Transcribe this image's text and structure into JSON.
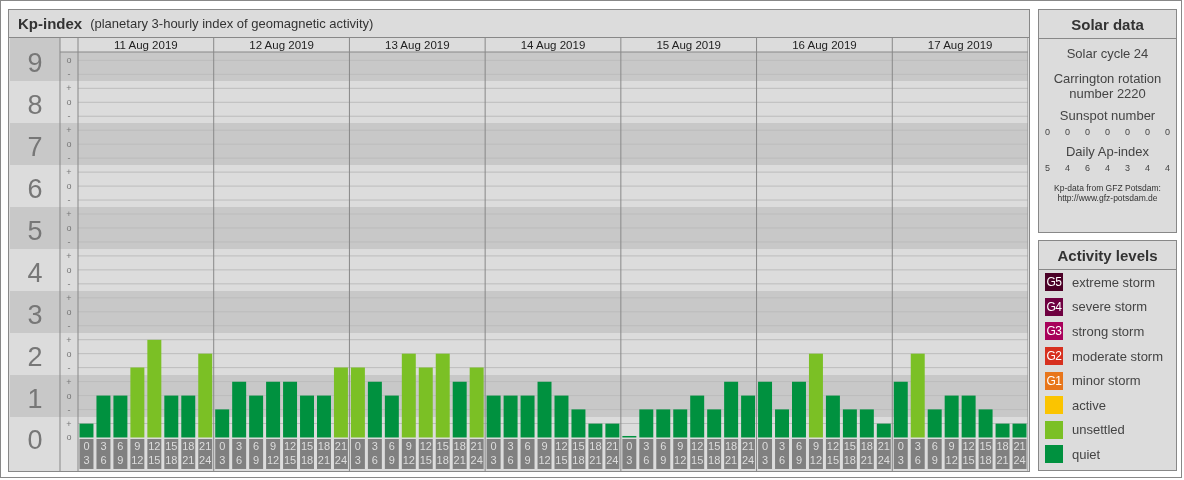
{
  "kp_panel": {
    "title": "Kp-index",
    "subtitle": "(planetary 3-hourly index of geomagnetic activity)",
    "days": [
      "11 Aug 2019",
      "12 Aug 2019",
      "13 Aug 2019",
      "14 Aug 2019",
      "15 Aug 2019",
      "16 Aug 2019",
      "17 Aug 2019"
    ],
    "sub_marks": [
      "o",
      "-",
      "+",
      "o",
      "-",
      "+",
      "o",
      "-",
      "+",
      "o",
      "-",
      "+",
      "o",
      "-",
      "+",
      "o",
      "-",
      "+",
      "o",
      "-",
      "+",
      "o",
      "-",
      "+",
      "o",
      "-",
      "+",
      "o"
    ],
    "chart_data": {
      "type": "bar",
      "stacked": true,
      "grid": true,
      "ylim": [
        -0.8,
        9.2
      ],
      "yticks": [
        {
          "value": 0,
          "label": "0"
        },
        {
          "value": 1,
          "label": "1"
        },
        {
          "value": 2,
          "label": "2"
        },
        {
          "value": 3,
          "label": "3"
        },
        {
          "value": 4,
          "label": "4"
        },
        {
          "value": 5,
          "label": "5"
        },
        {
          "value": 6,
          "label": "6"
        },
        {
          "value": 7,
          "label": "7"
        },
        {
          "value": 8,
          "label": "8"
        },
        {
          "value": 9,
          "label": "9"
        }
      ],
      "categories": [
        "0 3",
        "3 6",
        "6 9",
        "9 12",
        "12 15",
        "15 18",
        "18 21",
        "21 24",
        "0 3",
        "3 6",
        "6 9",
        "9 12",
        "12 15",
        "15 18",
        "18 21",
        "21 24",
        "0 3",
        "3 6",
        "6 9",
        "9 12",
        "12 15",
        "15 18",
        "18 21",
        "21 24",
        "0 3",
        "3 6",
        "6 9",
        "9 12",
        "12 15",
        "15 18",
        "18 21",
        "21 24",
        "0 3",
        "3 6",
        "6 9",
        "9 12",
        "12 15",
        "15 18",
        "18 21",
        "21 24",
        "0 3",
        "3 6",
        "6 9",
        "9 12",
        "12 15",
        "15 18",
        "18 21",
        "21 24",
        "0 3",
        "3 6",
        "6 9",
        "9 12",
        "12 15",
        "15 18",
        "18 21",
        "21 24"
      ],
      "series": [
        {
          "color": "#00913f",
          "values": [
            0.33,
            1,
            1,
            null,
            null,
            1,
            1,
            null,
            0.67,
            1.33,
            1,
            1.33,
            1.33,
            1,
            1,
            null,
            null,
            1.33,
            1,
            null,
            null,
            null,
            1.33,
            null,
            1,
            1,
            1,
            1.33,
            1,
            0.67,
            0.33,
            0.33,
            0,
            0.67,
            0.67,
            0.67,
            1,
            0.67,
            1.33,
            1,
            1.33,
            0.67,
            1.33,
            null,
            1,
            0.67,
            0.67,
            0.33,
            1.33,
            null,
            0.67,
            1,
            1,
            0.67,
            0.33,
            0.33
          ]
        },
        {
          "color": "#7bc025",
          "values": [
            null,
            null,
            null,
            1.67,
            2.33,
            null,
            null,
            2,
            null,
            null,
            null,
            null,
            null,
            null,
            null,
            1.67,
            1.67,
            null,
            null,
            2,
            1.67,
            2,
            null,
            1.67,
            null,
            null,
            null,
            null,
            null,
            null,
            null,
            null,
            null,
            null,
            null,
            null,
            null,
            null,
            null,
            null,
            null,
            null,
            null,
            2,
            null,
            null,
            null,
            null,
            null,
            2,
            null,
            null,
            null,
            null,
            null,
            null
          ]
        }
      ]
    }
  },
  "solar_data": {
    "title": "Solar data",
    "solar_cycle": "Solar cycle 24",
    "carrington": "Carrington rotation number 2220",
    "sunspot_label": "Sunspot number",
    "sunspot_numbers": [
      "0",
      "0",
      "0",
      "0",
      "0",
      "0",
      "0"
    ],
    "ap_label": "Daily Ap-index",
    "ap_values": [
      "5",
      "4",
      "6",
      "4",
      "3",
      "4",
      "4"
    ],
    "credit": "Kp-data from GFZ Potsdam:",
    "credit_url": "http://www.gfz-potsdam.de"
  },
  "activity_levels": {
    "title": "Activity levels",
    "items": [
      {
        "badge": "G5",
        "label": "extreme storm",
        "color": "#4b0026"
      },
      {
        "badge": "G4",
        "label": "severe storm",
        "color": "#6e0040"
      },
      {
        "badge": "G3",
        "label": "strong storm",
        "color": "#a8005a"
      },
      {
        "badge": "G2",
        "label": "moderate storm",
        "color": "#d7301f"
      },
      {
        "badge": "G1",
        "label": "minor storm",
        "color": "#e8761b"
      },
      {
        "label": "active",
        "color": "#fbc400"
      },
      {
        "label": "unsettled",
        "color": "#7bc025"
      },
      {
        "label": "quiet",
        "color": "#00913f"
      }
    ]
  }
}
